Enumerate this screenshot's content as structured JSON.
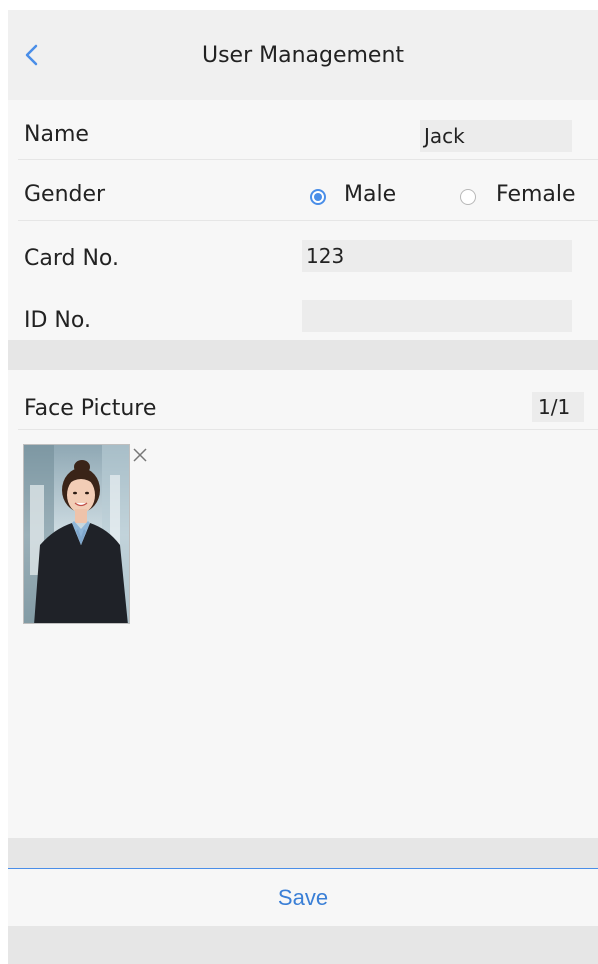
{
  "header": {
    "title": "User Management",
    "back_icon": "chevron-left-icon"
  },
  "form": {
    "name": {
      "label": "Name",
      "value": "Jack"
    },
    "gender": {
      "label": "Gender",
      "options": [
        {
          "label": "Male",
          "selected": true
        },
        {
          "label": "Female",
          "selected": false
        }
      ]
    },
    "card_no": {
      "label": "Card No.",
      "value": "123"
    },
    "id_no": {
      "label": "ID No.",
      "value": ""
    }
  },
  "face_picture": {
    "label": "Face Picture",
    "count": "1/1",
    "remove_icon": "close-icon"
  },
  "footer": {
    "save_label": "Save"
  },
  "colors": {
    "accent": "#4a8ee8",
    "save_text": "#3a7fd6",
    "background": "#f7f7f7",
    "band": "#e6e6e6",
    "field": "#ececec"
  }
}
